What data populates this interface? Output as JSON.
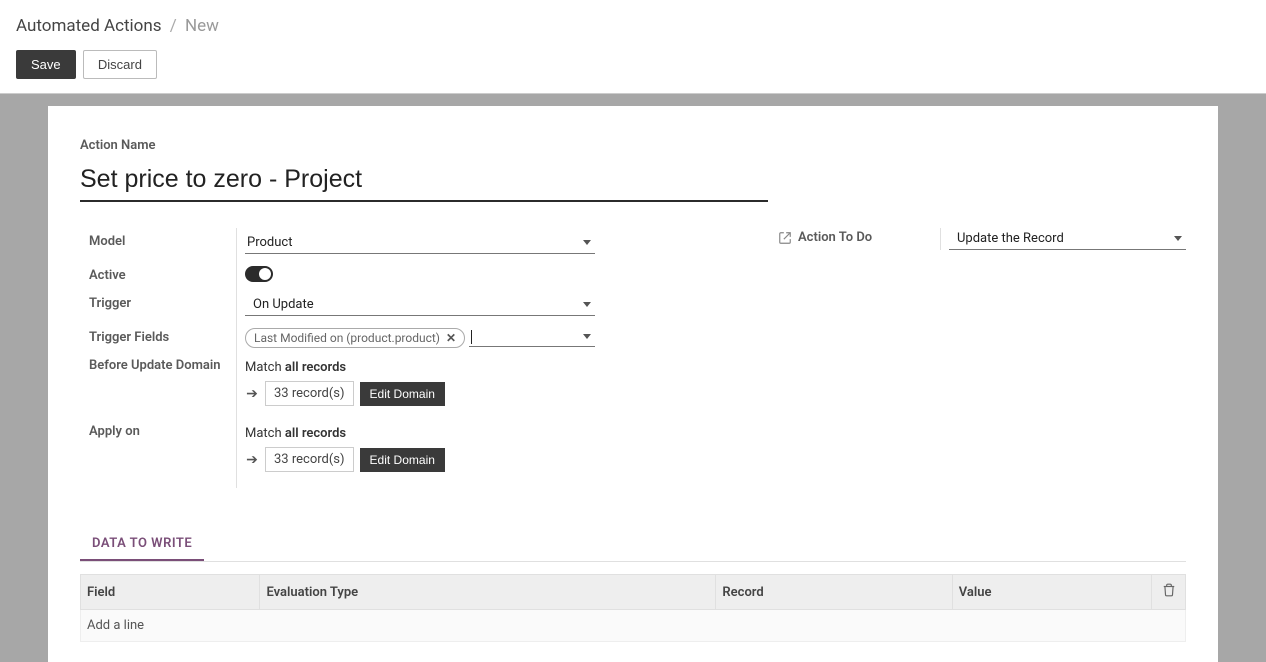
{
  "breadcrumb": {
    "main": "Automated Actions",
    "new": "New"
  },
  "buttons": {
    "save": "Save",
    "discard": "Discard",
    "edit_domain": "Edit Domain"
  },
  "labels": {
    "action_name": "Action Name",
    "model": "Model",
    "active": "Active",
    "trigger": "Trigger",
    "trigger_fields": "Trigger Fields",
    "before_update_domain": "Before Update Domain",
    "apply_on": "Apply on",
    "action_to_do": "Action To Do"
  },
  "values": {
    "action_name": "Set price to zero - Project",
    "model": "Product",
    "trigger": "On Update",
    "trigger_field_tag": "Last Modified on (product.product)",
    "action_to_do": "Update the Record"
  },
  "domain": {
    "match_prefix": "Match ",
    "match_bold": "all records",
    "records_count": "33 record(s)"
  },
  "tabs": {
    "data_to_write": "DATA TO WRITE"
  },
  "table": {
    "headers": {
      "field": "Field",
      "evaluation_type": "Evaluation Type",
      "record": "Record",
      "value": "Value"
    },
    "add_line": "Add a line"
  }
}
